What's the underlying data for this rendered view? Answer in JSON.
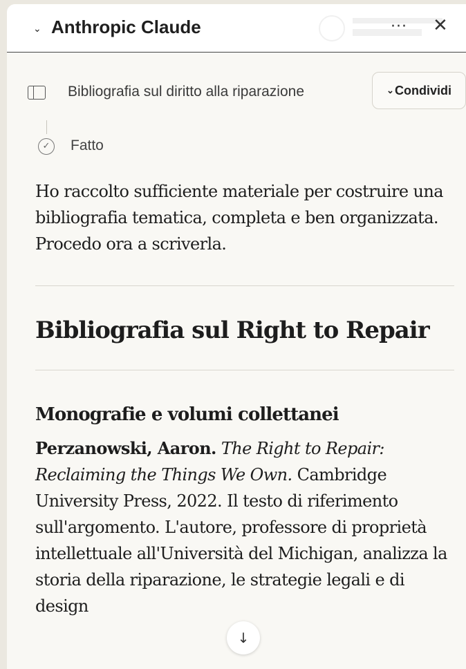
{
  "header": {
    "chevron_icon": "chevron-down-icon",
    "app_title": "Anthropic Claude",
    "more_glyph": "···",
    "close_glyph": "✕"
  },
  "conversation": {
    "title": "Bibliografia sul diritto alla riparazione",
    "share_label": "Condividi"
  },
  "status": {
    "done_label": "Fatto"
  },
  "message": {
    "intro": "Ho raccolto sufficiente materiale per costruire una bibliografia tematica, completa e ben organizzata. Procedo ora a scriverla.",
    "heading": "Bibliografia sul Right to Repair",
    "section_heading": "Monografie e volumi collettanei",
    "entry": {
      "author": "Perzanowski, Aaron.",
      "work_title": "The Right to Repair: Reclaiming the Things We Own.",
      "publication": "Cambridge University Press, 2022.",
      "description": "Il testo di riferimento sull'argomento. L'autore, professore di proprietà intellettuale all'Università del Michigan, analizza la storia della riparazione, le strategie legali e di design"
    }
  },
  "colors": {
    "background": "#ebe8e0",
    "panel": "#f9f8f4",
    "text": "#1d1d1d"
  }
}
